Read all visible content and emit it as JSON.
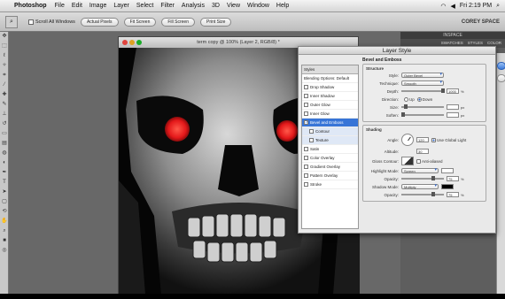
{
  "menubar": {
    "app_name": "Photoshop",
    "items": [
      "File",
      "Edit",
      "Image",
      "Layer",
      "Select",
      "Filter",
      "Analysis",
      "3D",
      "View",
      "Window",
      "Help"
    ],
    "clock": "Fri 2:19 PM",
    "apple_icon": "apple-icon"
  },
  "options": {
    "scroll_all_windows": "Scroll All Windows",
    "buttons": [
      "Actual Pixels",
      "Fit Screen",
      "Fill Screen",
      "Print Size"
    ],
    "workspace": "COREY SPACE"
  },
  "document": {
    "title": "term copy @ 100% (Layer 2, RGB/8) *"
  },
  "dock": {
    "header": "INSPACE",
    "tabs": [
      "SWATCHES",
      "STYLES",
      "COLOR"
    ]
  },
  "dialog": {
    "title": "Layer Style",
    "styles_header": "Styles",
    "list": [
      {
        "label": "Blending Options: Default",
        "checkbox": false,
        "selected": false,
        "sub": false
      },
      {
        "label": "Drop Shadow",
        "checkbox": true,
        "selected": false,
        "sub": false
      },
      {
        "label": "Inner Shadow",
        "checkbox": true,
        "selected": false,
        "sub": false
      },
      {
        "label": "Outer Glow",
        "checkbox": true,
        "selected": false,
        "sub": false
      },
      {
        "label": "Inner Glow",
        "checkbox": true,
        "selected": false,
        "sub": false
      },
      {
        "label": "Bevel and Emboss",
        "checkbox": true,
        "selected": true,
        "sub": false
      },
      {
        "label": "Contour",
        "checkbox": true,
        "selected": false,
        "sub": true
      },
      {
        "label": "Texture",
        "checkbox": true,
        "selected": false,
        "sub": true
      },
      {
        "label": "Satin",
        "checkbox": true,
        "selected": false,
        "sub": false
      },
      {
        "label": "Color Overlay",
        "checkbox": true,
        "selected": false,
        "sub": false
      },
      {
        "label": "Gradient Overlay",
        "checkbox": true,
        "selected": false,
        "sub": false
      },
      {
        "label": "Pattern Overlay",
        "checkbox": true,
        "selected": false,
        "sub": false
      },
      {
        "label": "Stroke",
        "checkbox": true,
        "selected": false,
        "sub": false
      }
    ],
    "section_title": "Bevel and Emboss",
    "structure": {
      "title": "Structure",
      "style_label": "Style:",
      "style_value": "Outer Bevel",
      "technique_label": "Technique:",
      "technique_value": "Smooth",
      "depth_label": "Depth:",
      "depth_value": "1000",
      "depth_unit": "%",
      "depth_level": 0.98,
      "direction_label": "Direction:",
      "dir_up": "Up",
      "dir_down": "Down",
      "size_label": "Size:",
      "size_unit": "px",
      "size_level": 0.1,
      "soften_label": "Soften:",
      "soften_unit": "px",
      "soften_level": 0.05
    },
    "shading": {
      "title": "Shading",
      "angle_label": "Angle:",
      "angle_value": "120",
      "global_light": "Use Global Light",
      "altitude_label": "Altitude:",
      "altitude_value": "30",
      "gloss_label": "Gloss Contour:",
      "anti_aliased": "Anti-aliased",
      "highlight_label": "Highlight Mode:",
      "highlight_value": "Screen",
      "hl_opacity_label": "Opacity:",
      "hl_opacity_value": "75",
      "hl_opacity_level": 0.75,
      "shadow_label": "Shadow Mode:",
      "shadow_value": "Multiply",
      "sh_opacity_label": "Opacity:",
      "sh_opacity_value": "75",
      "sh_opacity_level": 0.75,
      "unit": "%"
    }
  },
  "colors": {
    "eye_red": "#e4181a",
    "highlight_blue": "#3875d7",
    "shadow_swatch": "#000000"
  }
}
